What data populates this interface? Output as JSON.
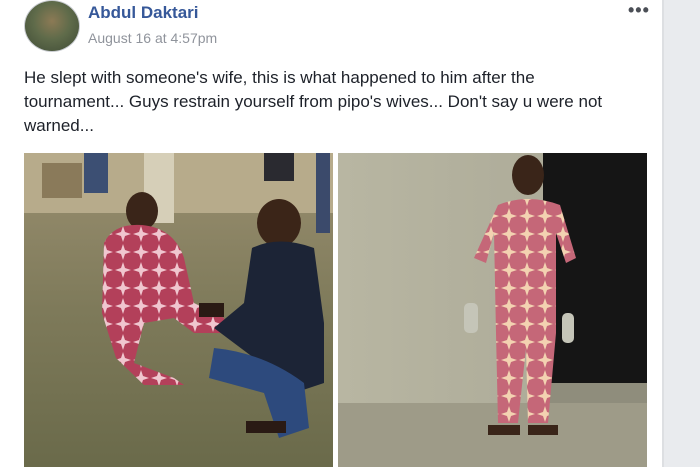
{
  "post": {
    "author": "Abdul Daktari",
    "timestamp": "August 16 at 4:57pm",
    "more_icon": "more-options-icon",
    "text": "He slept with someone's wife, this is what happened to him after the tournament... Guys restrain yourself from pipo's wives... Don't say u were not warned..."
  },
  "colors": {
    "author_link": "#365899",
    "meta_text": "#90949c",
    "body_text": "#1d2129",
    "card_bg": "#ffffff",
    "page_bg": "#e9ebee"
  }
}
